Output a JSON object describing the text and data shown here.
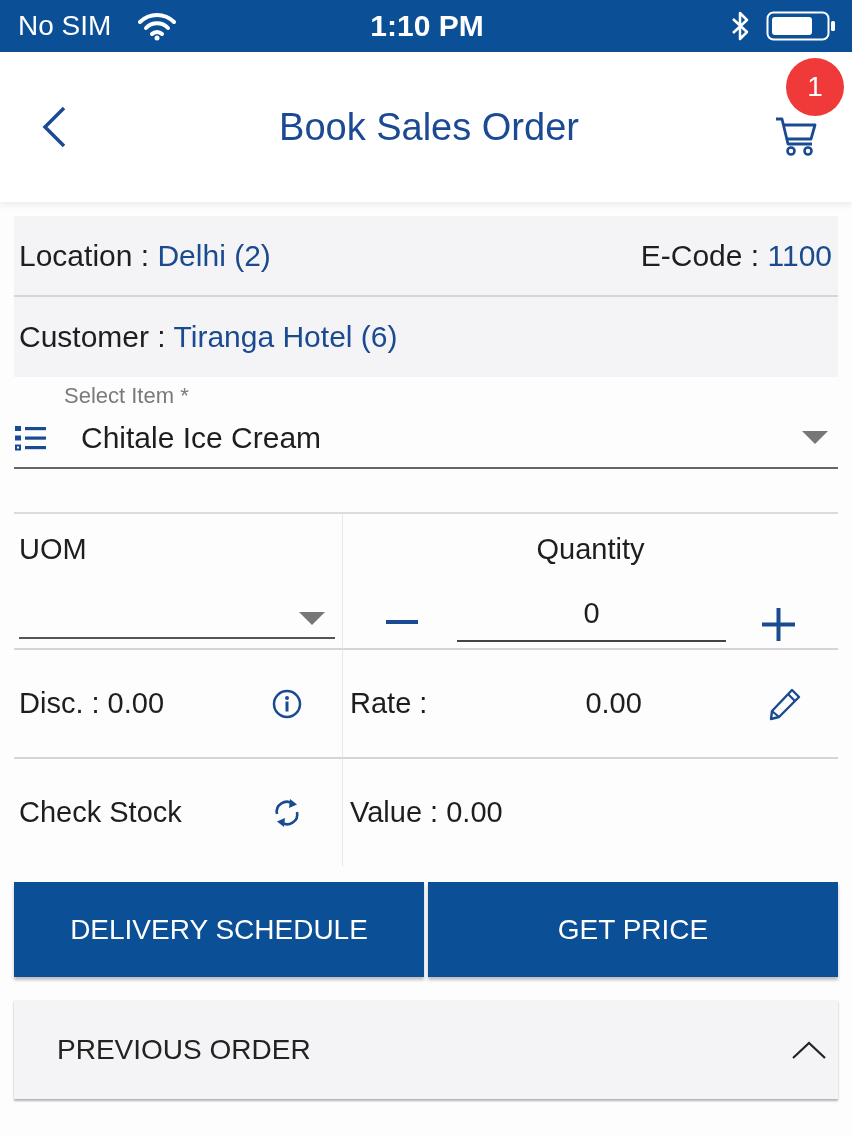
{
  "status_bar": {
    "carrier": "No SIM",
    "time": "1:10 PM"
  },
  "header": {
    "title": "Book Sales Order",
    "cart_count": "1"
  },
  "info": {
    "location": {
      "label": "Location :",
      "value": "Delhi (2)"
    },
    "e_code": {
      "label": "E-Code :",
      "value": "1100"
    },
    "customer": {
      "label": "Customer :",
      "value": "Tiranga Hotel (6)"
    }
  },
  "item_select": {
    "label": "Select Item *",
    "value": "Chitale Ice Cream"
  },
  "uom": {
    "label": "UOM"
  },
  "quantity": {
    "label": "Quantity",
    "value": "0"
  },
  "discount": {
    "text": "Disc. : 0.00"
  },
  "rate": {
    "label": "Rate :",
    "value": "0.00"
  },
  "check_stock": {
    "label": "Check Stock"
  },
  "total_value": {
    "text": "Value : 0.00"
  },
  "buttons": [
    {
      "label": "DELIVERY SCHEDULE"
    },
    {
      "label": "GET PRICE"
    }
  ],
  "previous_order": {
    "label": "PREVIOUS ORDER"
  }
}
